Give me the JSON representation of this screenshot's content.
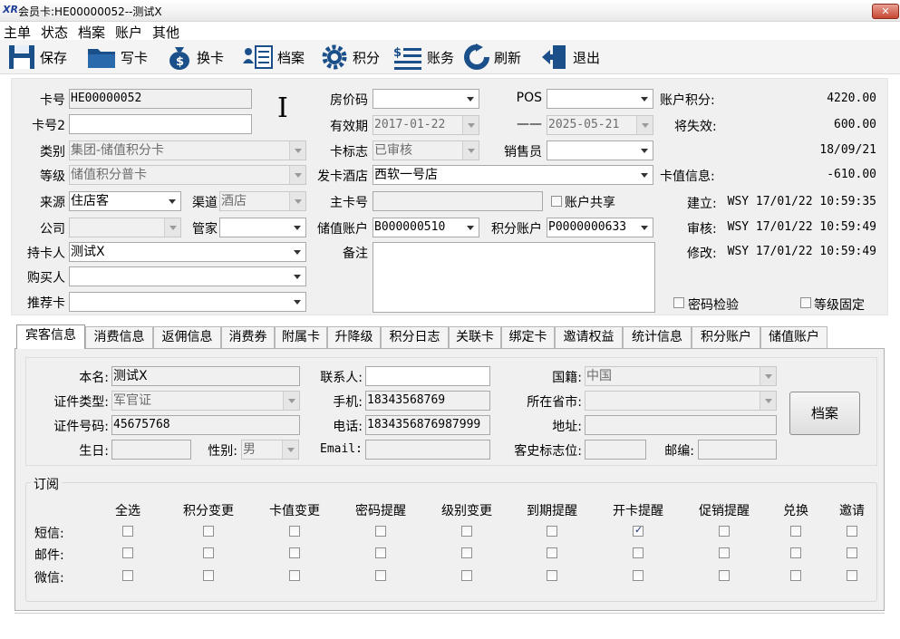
{
  "window": {
    "title": "会员卡:HE00000052--测试X",
    "close_label": "✕"
  },
  "menu": [
    "主单",
    "状态",
    "档案",
    "账户",
    "其他"
  ],
  "toolbar": {
    "save": "保存",
    "write_card": "写卡",
    "change_card": "换卡",
    "archive": "档案",
    "points": "积分",
    "account": "账务",
    "refresh": "刷新",
    "exit": "退出"
  },
  "form": {
    "card_no_label": "卡号",
    "card_no": "HE00000052",
    "card_no2_label": "卡号2",
    "card_no2": "",
    "type_label": "类别",
    "type": "集团-储值积分卡",
    "level_label": "等级",
    "level": "储值积分普卡",
    "source_label": "来源",
    "source": "住店客",
    "channel_label": "渠道",
    "channel": "酒店",
    "company_label": "公司",
    "company": "",
    "butler_label": "管家",
    "butler": "",
    "holder_label": "持卡人",
    "holder": "测试X",
    "buyer_label": "购买人",
    "buyer": "",
    "referrer_label": "推荐卡",
    "referrer": "",
    "room_rate_label": "房价码",
    "room_rate": "",
    "pos_label": "POS",
    "pos": "",
    "valid_label": "有效期",
    "valid_from": "2017-01-22",
    "valid_sep": "——",
    "valid_to": "2025-05-21",
    "card_flag_label": "卡标志",
    "card_flag": "已审核",
    "sales_label": "销售员",
    "sales": "",
    "issue_hotel_label": "发卡酒店",
    "issue_hotel": "西软一号店",
    "master_card_label": "主卡号",
    "master_card": "",
    "share_account_label": "账户共享",
    "stored_account_label": "储值账户",
    "stored_account": "B000000510",
    "points_account_label": "积分账户",
    "points_account": "P0000000633",
    "remark_label": "备注",
    "remark": ""
  },
  "summary": {
    "points_label": "账户积分:",
    "points": "4220.00",
    "expiring_label": "将失效:",
    "expiring": "600.00",
    "expiring_date": "18/09/21",
    "stored_label": "卡值信息:",
    "stored": "-610.00",
    "created_label": "建立:",
    "created": "WSY 17/01/22 10:59:35",
    "audited_label": "审核:",
    "audited": "WSY 17/01/22 10:59:49",
    "modified_label": "修改:",
    "modified": "WSY 17/01/22 10:59:49",
    "pwd_check_label": "密码检验",
    "level_fixed_label": "等级固定"
  },
  "tabs": [
    "宾客信息",
    "消费信息",
    "返佣信息",
    "消费券",
    "附属卡",
    "升降级",
    "积分日志",
    "关联卡",
    "绑定卡",
    "邀请权益",
    "统计信息",
    "积分账户",
    "储值账户"
  ],
  "guest": {
    "name_label": "本名:",
    "name": "测试X",
    "contact_label": "联系人:",
    "contact": "",
    "nation_label": "国籍:",
    "nation": "中国",
    "id_type_label": "证件类型:",
    "id_type": "军官证",
    "mobile_label": "手机:",
    "mobile": "18343568769",
    "province_label": "所在省市:",
    "province": "",
    "id_no_label": "证件号码:",
    "id_no": "45675768",
    "phone_label": "电话:",
    "phone": "1834356876987999",
    "address_label": "地址:",
    "address": "",
    "birthday_label": "生日:",
    "birthday": "",
    "gender_label": "性别:",
    "gender": "男",
    "email_label": "Email:",
    "email": "",
    "guest_flag_label": "客史标志位:",
    "guest_flag": "",
    "zip_label": "邮编:",
    "zip": "",
    "archive_button": "档案"
  },
  "subscribe": {
    "title": "订阅",
    "columns": [
      "全选",
      "积分变更",
      "卡值变更",
      "密码提醒",
      "级别变更",
      "到期提醒",
      "开卡提醒",
      "促销提醒",
      "兑换",
      "邀请"
    ],
    "rows": [
      {
        "label": "短信:",
        "checked": [
          false,
          false,
          false,
          false,
          false,
          false,
          true,
          false,
          false,
          false
        ]
      },
      {
        "label": "邮件:",
        "checked": [
          false,
          false,
          false,
          false,
          false,
          false,
          false,
          false,
          false,
          false
        ]
      },
      {
        "label": "微信:",
        "checked": [
          false,
          false,
          false,
          false,
          false,
          false,
          false,
          false,
          false,
          false
        ]
      }
    ]
  }
}
